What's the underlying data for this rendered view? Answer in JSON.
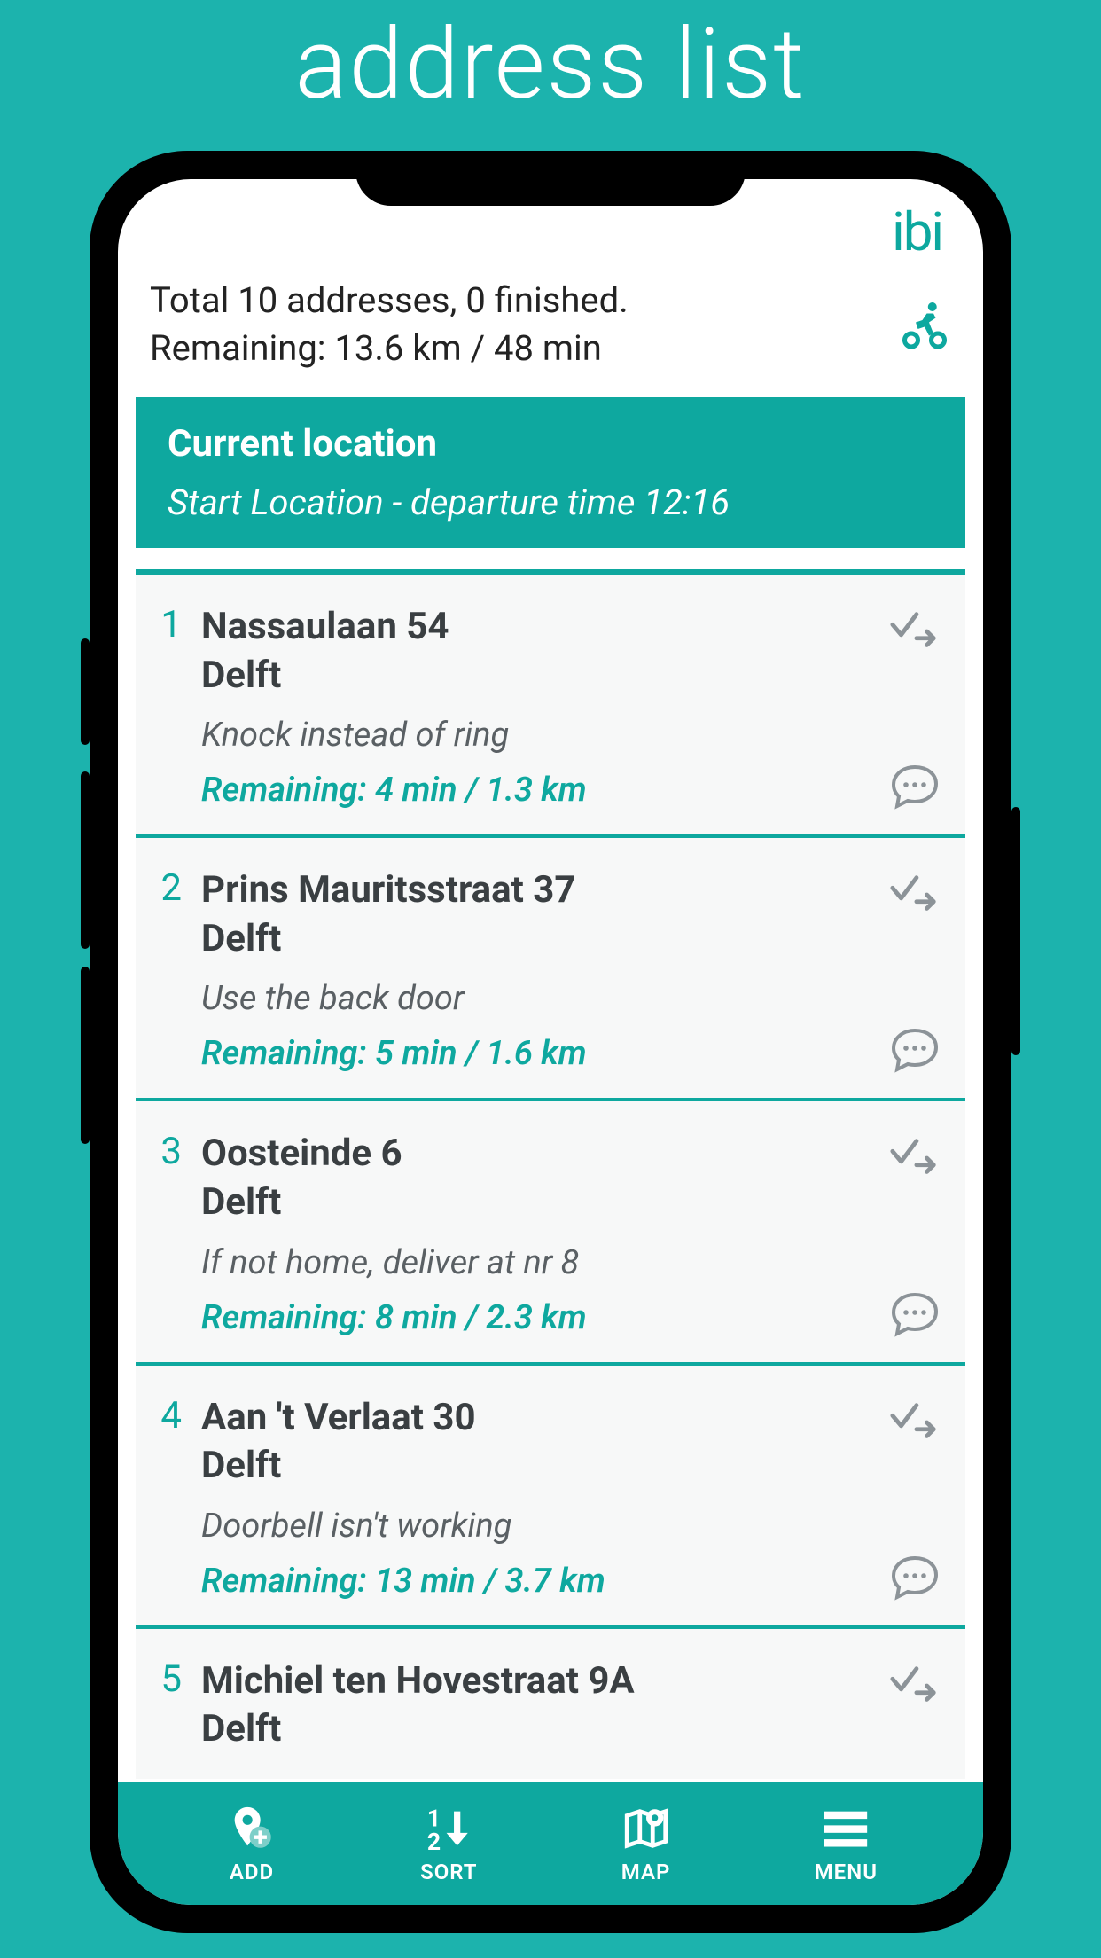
{
  "page_title": "address list",
  "logo": "ibi",
  "summary": {
    "line1": "Total 10 addresses, 0 finished.",
    "line2": "Remaining: 13.6 km / 48 min"
  },
  "current_location": {
    "title": "Current location",
    "subtitle": "Start Location - departure time 12:16"
  },
  "addresses": [
    {
      "num": "1",
      "street": "Nassaulaan 54",
      "city": "Delft",
      "note": "Knock instead of ring",
      "remaining": "Remaining: 4 min / 1.3 km"
    },
    {
      "num": "2",
      "street": "Prins Mauritsstraat 37",
      "city": "Delft",
      "note": "Use the back door",
      "remaining": "Remaining: 5 min / 1.6 km"
    },
    {
      "num": "3",
      "street": "Oosteinde 6",
      "city": "Delft",
      "note": "If not home, deliver at nr 8",
      "remaining": "Remaining: 8 min / 2.3 km"
    },
    {
      "num": "4",
      "street": "Aan 't Verlaat 30",
      "city": "Delft",
      "note": "Doorbell isn't working",
      "remaining": "Remaining: 13 min / 3.7 km"
    },
    {
      "num": "5",
      "street": "Michiel ten Hovestraat 9A",
      "city": "Delft",
      "note": "",
      "remaining": ""
    }
  ],
  "nav": {
    "add": "ADD",
    "sort": "SORT",
    "map": "MAP",
    "menu": "MENU"
  }
}
